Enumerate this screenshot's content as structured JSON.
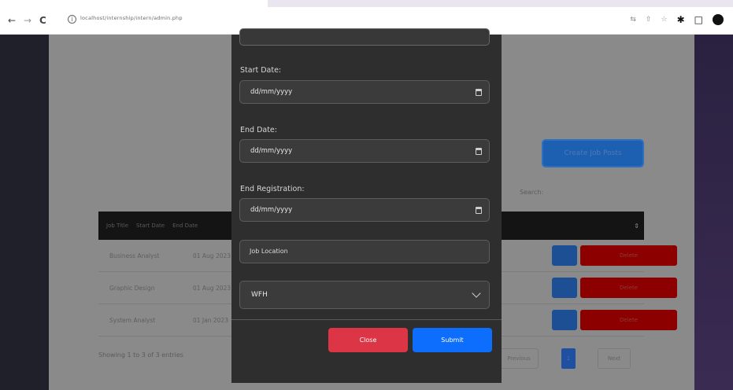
{
  "browser": {
    "url": "localhost/internship/intern/admin.php",
    "back_icon": "arrow-left-icon",
    "forward_icon": "arrow-right-icon",
    "reload_icon": "reload-icon"
  },
  "page": {
    "create_job_label": "Create Job Posts",
    "search_label": "Search:",
    "table": {
      "columns": [
        "Job Title",
        "Start Date",
        "End Date"
      ],
      "rows": [
        {
          "title": "Business Analyst",
          "date": "01 Aug 2023"
        },
        {
          "title": "Graphic Design",
          "date": "01 Aug 2023"
        },
        {
          "title": "System Analyst",
          "date": "01 Jan 2023"
        }
      ],
      "delete_label": "Delete"
    },
    "showing_text": "Showing 1 to 3 of 3 entries",
    "pagination": {
      "previous": "Previous",
      "current": "1",
      "next": "Next"
    }
  },
  "modal": {
    "start_date_label": "Start Date:",
    "start_date_value": "dd/mm/yyyy",
    "end_date_label": "End Date:",
    "end_date_value": "dd/mm/yyyy",
    "end_registration_label": "End Registration:",
    "end_registration_value": "dd/mm/yyyy",
    "job_location_placeholder": "Job Location",
    "work_mode_value": "WFH",
    "close_label": "Close",
    "submit_label": "Submit"
  }
}
